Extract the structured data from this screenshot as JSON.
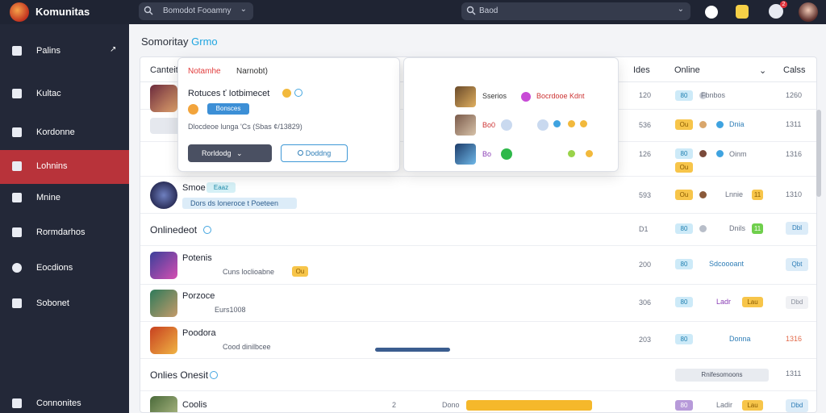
{
  "app": {
    "name": "Komunitas"
  },
  "topbar": {
    "search_left": {
      "placeholder": "Bomodot Fooamny",
      "chev": "⌄"
    },
    "search_right": {
      "placeholder": "Baod",
      "chev": "⌄"
    },
    "notif_count": "2"
  },
  "sidebar": {
    "items": [
      {
        "label": "Palins",
        "arrow": "↗",
        "icon": "home-icon"
      },
      {
        "label": "Kultac",
        "icon": "chart-icon"
      },
      {
        "label": "Kordonne",
        "icon": "folder-icon"
      },
      {
        "label": "Lohnins",
        "icon": "users-icon",
        "active": true
      },
      {
        "label": "Mnine",
        "icon": "grid-icon"
      },
      {
        "label": "Rormdarhos",
        "icon": "chat-icon"
      },
      {
        "label": "Eocdions",
        "icon": "circle-icon"
      },
      {
        "label": "Sobonet",
        "icon": "settings-icon"
      },
      {
        "label": "Connonites",
        "icon": "group-icon"
      }
    ]
  },
  "main": {
    "title_main": "Somoritay",
    "title_accent": "Grmo",
    "columns": {
      "name": "Canteit",
      "ldes": "Ides",
      "online": "Online",
      "online_chev": "⌄",
      "calss": "Calss"
    },
    "rows": [
      {
        "extra": "",
        "num": "120",
        "status": "Fbnbos",
        "c": "1260"
      },
      {
        "num": "536",
        "status": "Dnia",
        "c": "1311"
      },
      {
        "num": "126",
        "status": "Oinm",
        "c": "1316"
      },
      {
        "name": "Smoe",
        "badge": "Eaaz",
        "sub": "Dors ds loneroce  t Poeteen",
        "num": "593",
        "status": "Lnnie",
        "c": "1310"
      }
    ],
    "sections": [
      {
        "title": "Onlinedeot",
        "cell": "D1",
        "status": "Dnils",
        "btn": "Dbl"
      },
      {
        "title": "Onlies Onesit",
        "pill": "Rnifesomoons",
        "c": "1311"
      }
    ],
    "players": [
      {
        "name": "Potenis",
        "sub": "Cuns loclioabne",
        "num": "200",
        "status": "Sdcoooant",
        "btn": "Qbt"
      },
      {
        "name": "Porzoce",
        "sub": "Eurs1008",
        "num": "306",
        "status": "Ladr",
        "btn": "Dbd"
      },
      {
        "name": "Poodora",
        "sub": "Cood dinilbcee",
        "num": "203",
        "status": "Donna",
        "c": "1316"
      },
      {
        "name": "Coolis",
        "num": "2",
        "mid": "Dono",
        "status": "Ladir",
        "btn": "Dbd"
      }
    ],
    "pill_labels": [
      "80",
      "Ou",
      "Wu",
      "Lau",
      "11"
    ]
  },
  "popup": {
    "tab_active": "Notamhe",
    "tab_other": "Narnobt)",
    "title": "Rotuces ť Iotbimecet",
    "chip": "Bonsces",
    "meta": "Dlocdeoe lunga 'Cs (Sbas ¢/13829)",
    "btn_primary": "Rorldodg",
    "btn_primary_chev": "⌄",
    "btn_secondary": "Doddng"
  },
  "popup2": {
    "rows": [
      {
        "label": "Sserios",
        "extra": "Bocrdooe Kdnt"
      },
      {
        "label": "Bo0"
      },
      {
        "label": "Bo"
      }
    ]
  },
  "colors": {
    "accent_red": "#b8333a",
    "accent_blue": "#1fa5e0",
    "sidebar_bg": "#232838"
  }
}
